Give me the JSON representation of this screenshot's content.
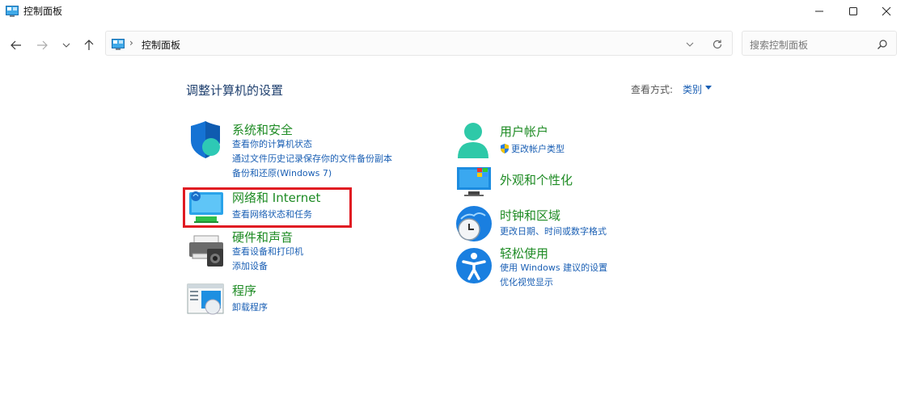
{
  "window": {
    "title": "控制面板"
  },
  "address": {
    "crumb": "控制面板",
    "separator": "›"
  },
  "search": {
    "placeholder": "搜索控制面板"
  },
  "main": {
    "heading": "调整计算机的设置",
    "view_label": "查看方式:",
    "view_value": "类别"
  },
  "categories": {
    "system": {
      "title": "系统和安全",
      "links": [
        "查看你的计算机状态",
        "通过文件历史记录保存你的文件备份副本",
        "备份和还原(Windows 7)"
      ]
    },
    "network": {
      "title": "网络和 Internet",
      "links": [
        "查看网络状态和任务"
      ]
    },
    "hardware": {
      "title": "硬件和声音",
      "links": [
        "查看设备和打印机",
        "添加设备"
      ]
    },
    "programs": {
      "title": "程序",
      "links": [
        "卸载程序"
      ]
    },
    "user": {
      "title": "用户帐户",
      "links": [
        "更改帐户类型"
      ]
    },
    "appearance": {
      "title": "外观和个性化",
      "links": []
    },
    "clock": {
      "title": "时钟和区域",
      "links": [
        "更改日期、时间或数字格式"
      ]
    },
    "access": {
      "title": "轻松使用",
      "links": [
        "使用 Windows 建议的设置",
        "优化视觉显示"
      ]
    }
  },
  "colors": {
    "category_title": "#1e8b24",
    "link": "#1a5fb4",
    "heading": "#1e3f6e",
    "highlight": "#e01a22"
  }
}
